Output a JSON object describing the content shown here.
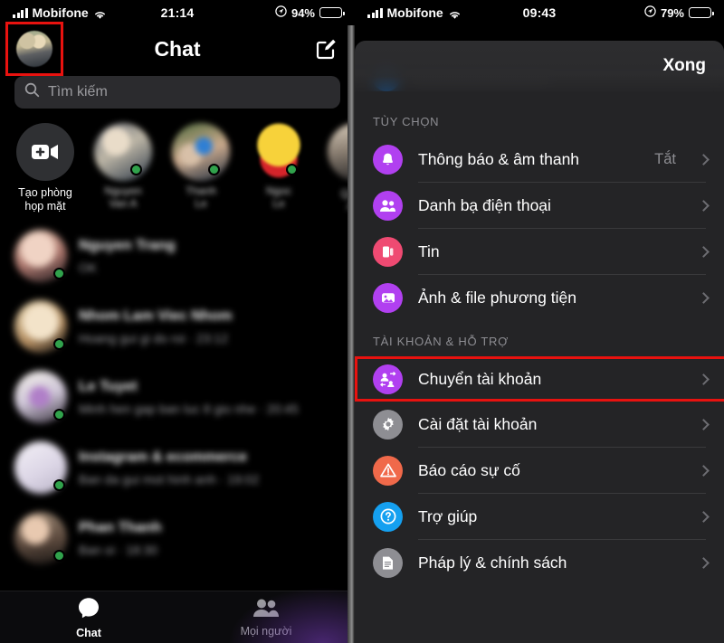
{
  "left": {
    "status_bar": {
      "carrier": "Mobifone",
      "time": "21:14",
      "battery_pct": "94%",
      "signal_icon": "signal-bars-icon",
      "wifi_icon": "wifi-icon",
      "battery_icon": "battery-icon",
      "location_icon": "location-arrow-icon"
    },
    "header": {
      "title": "Chat",
      "avatar_icon": "profile-avatar",
      "compose_icon": "compose-icon"
    },
    "search": {
      "placeholder": "Tìm kiếm",
      "icon": "search-icon"
    },
    "rooms": {
      "create_room": {
        "label": "Tạo phòng\nhọp mặt",
        "label_line1": "Tạo phòng",
        "label_line2": "họp mặt",
        "icon": "video-plus-icon"
      },
      "stories": [
        {
          "name": "",
          "online": true
        },
        {
          "name": "",
          "online": true
        },
        {
          "name": "",
          "online": true
        },
        {
          "name": "",
          "online": false
        }
      ]
    },
    "chat_list": [
      {
        "name": "",
        "snippet": "",
        "online": true
      },
      {
        "name": "",
        "snippet": "",
        "online": true
      },
      {
        "name": "",
        "snippet": "",
        "online": true
      },
      {
        "name": "",
        "snippet": "",
        "online": true
      },
      {
        "name": "",
        "snippet": "",
        "online": true
      }
    ],
    "tabbar": [
      {
        "label": "Chat",
        "icon": "chat-bubble-icon",
        "active": true
      },
      {
        "label": "Mọi người",
        "icon": "people-icon",
        "active": false
      }
    ]
  },
  "right": {
    "status_bar": {
      "carrier": "Mobifone",
      "time": "09:43",
      "battery_pct": "79%",
      "signal_icon": "signal-bars-icon",
      "wifi_icon": "wifi-icon",
      "battery_icon": "battery-icon",
      "location_icon": "location-arrow-icon"
    },
    "sheet": {
      "done_label": "Xong"
    },
    "sections": [
      {
        "title": "TÙY CHỌN",
        "items": [
          {
            "label": "Thông báo & âm thanh",
            "value": "Tắt",
            "icon": "bell-icon",
            "icon_color": "#b140f0",
            "highlighted": false
          },
          {
            "label": "Danh bạ điện thoại",
            "value": "",
            "icon": "contacts-icon",
            "icon_color": "#b140f0",
            "highlighted": false
          },
          {
            "label": "Tin",
            "value": "",
            "icon": "stories-icon",
            "icon_color": "#ef4a72",
            "highlighted": false
          },
          {
            "label": "Ảnh & file phương tiện",
            "value": "",
            "icon": "photo-icon",
            "icon_color": "#b140f0",
            "highlighted": false
          }
        ]
      },
      {
        "title": "TÀI KHOẢN & HỖ TRỢ",
        "items": [
          {
            "label": "Chuyển tài khoản",
            "value": "",
            "icon": "switch-account-icon",
            "icon_color": "#b140f0",
            "highlighted": true
          },
          {
            "label": "Cài đặt tài khoản",
            "value": "",
            "icon": "gear-icon",
            "icon_color": "#8e8e93",
            "highlighted": false
          },
          {
            "label": "Báo cáo sự cố",
            "value": "",
            "icon": "warning-icon",
            "icon_color": "#f0694a",
            "highlighted": false
          },
          {
            "label": "Trợ giúp",
            "value": "",
            "icon": "help-question-icon",
            "icon_color": "#15a0f0",
            "highlighted": false
          },
          {
            "label": "Pháp lý & chính sách",
            "value": "",
            "icon": "document-icon",
            "icon_color": "#8e8e93",
            "highlighted": false
          }
        ]
      }
    ]
  },
  "annotations": {
    "highlight_color": "#e8120f",
    "boxes": [
      {
        "target": "profile-avatar",
        "panel": "left"
      },
      {
        "target": "switch-account-row",
        "panel": "right"
      }
    ]
  }
}
